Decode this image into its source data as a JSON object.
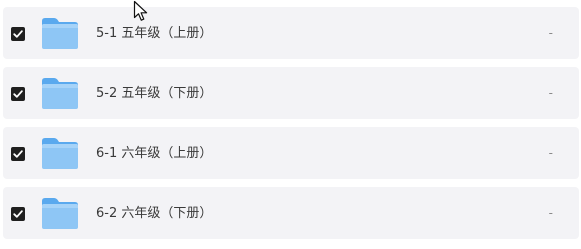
{
  "file_list": {
    "items": [
      {
        "name": "5-1 五年级（上册）",
        "meta": "-",
        "checked": true,
        "icon": "folder-icon"
      },
      {
        "name": "5-2 五年级（下册）",
        "meta": "-",
        "checked": true,
        "icon": "folder-icon"
      },
      {
        "name": "6-1 六年级（上册）",
        "meta": "-",
        "checked": true,
        "icon": "folder-icon"
      },
      {
        "name": "6-2 六年级（下册）",
        "meta": "-",
        "checked": true,
        "icon": "folder-icon"
      }
    ]
  },
  "colors": {
    "row_background": "#f3f3f6",
    "checkbox_fill": "#1f1f1f",
    "folder_front": "#8ec6f5",
    "folder_back": "#5aa9ee",
    "text": "#3a3a3a",
    "meta_text": "#8a8a8a"
  },
  "cursor": {
    "icon": "mouse-pointer-icon"
  }
}
